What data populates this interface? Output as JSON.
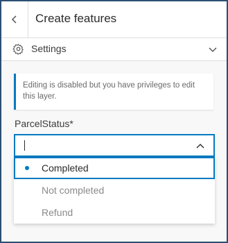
{
  "header": {
    "back_icon": "chevron-left-icon",
    "title": "Create features"
  },
  "settings": {
    "icon": "gear-icon",
    "label": "Settings",
    "toggle_icon": "chevron-down-icon"
  },
  "notice": {
    "text": "Editing is disabled but you have privileges to edit this layer."
  },
  "field": {
    "label": "ParcelStatus*",
    "value": "",
    "toggle_icon": "chevron-up-icon"
  },
  "dropdown": {
    "options": [
      {
        "label": "Completed",
        "selected": true
      },
      {
        "label": "Not completed",
        "selected": false
      },
      {
        "label": "Refund",
        "selected": false
      }
    ]
  },
  "colors": {
    "accent": "#007ac2",
    "frame_border": "#2c4f72"
  }
}
